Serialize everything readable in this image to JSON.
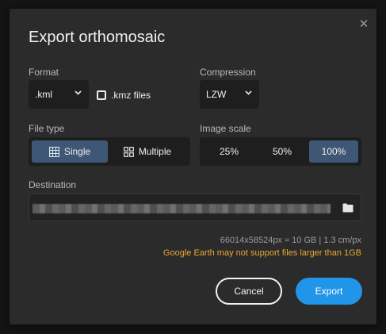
{
  "dialog": {
    "title": "Export orthomosaic",
    "close_icon": "close-icon"
  },
  "format": {
    "label": "Format",
    "value": ".kml",
    "kmz_checkbox": {
      "label": ".kmz files",
      "checked": false
    }
  },
  "compression": {
    "label": "Compression",
    "value": "LZW"
  },
  "file_type": {
    "label": "File type",
    "options": [
      {
        "label": "Single",
        "icon": "grid-icon",
        "selected": true
      },
      {
        "label": "Multiple",
        "icon": "tiles-icon",
        "selected": false
      }
    ]
  },
  "image_scale": {
    "label": "Image scale",
    "options": [
      {
        "label": "25%",
        "selected": false
      },
      {
        "label": "50%",
        "selected": false
      },
      {
        "label": "100%",
        "selected": true
      }
    ]
  },
  "destination": {
    "label": "Destination",
    "icon": "folder-icon"
  },
  "info": {
    "size_line": "66014x58524px ≈ 10 GB | 1.3 cm/px",
    "warning": "Google Earth may not support files larger than 1GB"
  },
  "actions": {
    "cancel": "Cancel",
    "export": "Export"
  },
  "colors": {
    "accent": "#2196e8",
    "selected_segment": "#3e5775",
    "warning": "#e8a631",
    "dialog_bg": "#2b2b2b"
  }
}
